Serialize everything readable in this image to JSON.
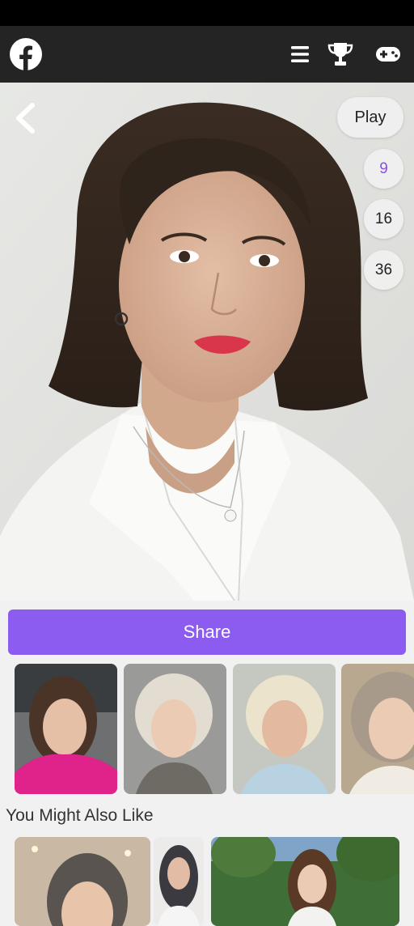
{
  "header": {
    "logo": "facebook-logo",
    "icons": [
      "menu-icon",
      "trophy-icon",
      "gamepad-icon"
    ]
  },
  "viewer": {
    "back_icon": "chevron-left-icon",
    "play_label": "Play",
    "grid_options": [
      "9",
      "16",
      "36"
    ],
    "active_grid": "9",
    "accent_color": "#8c5cf0"
  },
  "actions": {
    "share_label": "Share"
  },
  "related_section": {
    "title": "You Might Also Like"
  }
}
